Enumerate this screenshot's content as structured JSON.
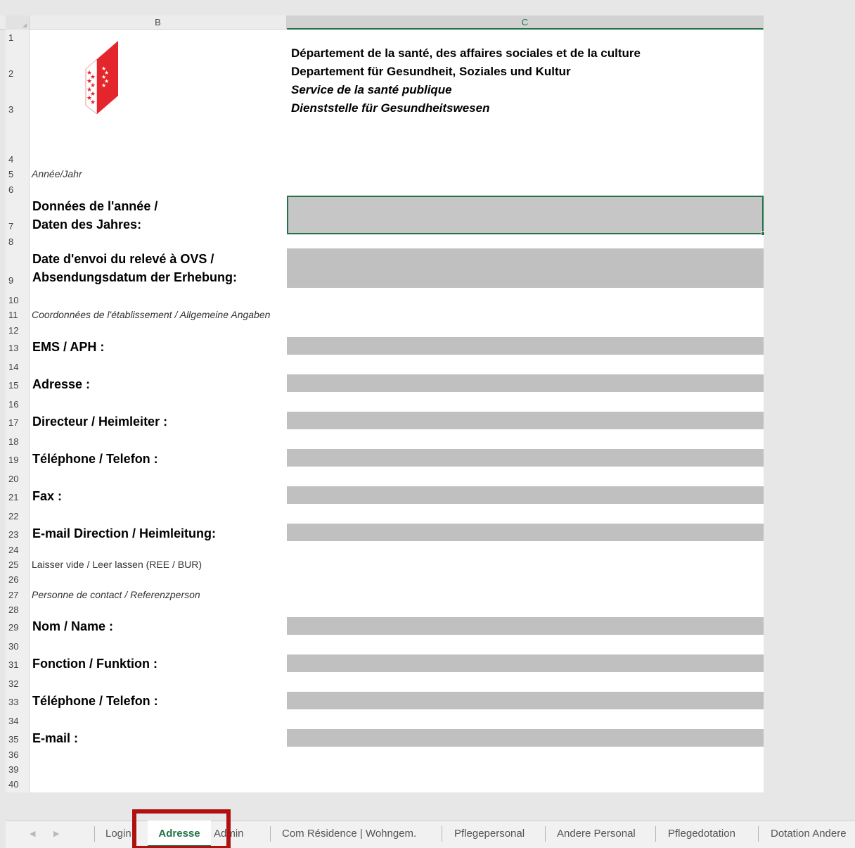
{
  "columns": [
    "B",
    "C"
  ],
  "rows": [
    "1",
    "2",
    "3",
    "4",
    "5",
    "6",
    "7",
    "8",
    "9",
    "10",
    "11",
    "12",
    "13",
    "14",
    "15",
    "16",
    "17",
    "18",
    "19",
    "20",
    "21",
    "22",
    "23",
    "24",
    "25",
    "26",
    "27",
    "28",
    "29",
    "30",
    "31",
    "32",
    "33",
    "34",
    "35",
    "36",
    "39",
    "40"
  ],
  "header": {
    "line1": "Département de la santé, des affaires sociales et de la culture",
    "line2": "Departement für Gesundheit, Soziales und Kultur",
    "line3": "Service de la santé publique",
    "line4": "Dienststelle für Gesundheitswesen"
  },
  "sections": {
    "year": "Année/Jahr",
    "establishment": "Coordonnées de l'établissement / Allgemeine Angaben",
    "leave_empty": "Laisser vide / Leer lassen (REE / BUR)",
    "contact": "Personne de contact / Referenzperson"
  },
  "labels": {
    "year_data_1": "Données de l'année /",
    "year_data_2": "Daten des Jahres:",
    "send_date_1": "Date d'envoi du relevé à OVS /",
    "send_date_2": "Absendungsdatum der Erhebung:",
    "ems": "EMS / APH :",
    "address": "Adresse :",
    "director": "Directeur / Heimleiter :",
    "phone": "Téléphone / Telefon :",
    "fax": "Fax :",
    "email_direction": "E-mail Direction / Heimleitung:",
    "name": "Nom / Name :",
    "function": "Fonction / Funktion :",
    "contact_phone": "Téléphone / Telefon :",
    "contact_email": "E-mail :"
  },
  "tabs": [
    {
      "label": "Login"
    },
    {
      "label": "Adresse"
    },
    {
      "label": "Admin"
    },
    {
      "label": "Com Résidence | Wohngem."
    },
    {
      "label": "Pflegepersonal"
    },
    {
      "label": "Andere Personal"
    },
    {
      "label": "Pflegedotation"
    },
    {
      "label": "Dotation Andere"
    }
  ],
  "colors": {
    "accent": "#217346",
    "field": "#c0c0c0",
    "highlight": "#b01010",
    "logo_red": "#e4252b"
  }
}
